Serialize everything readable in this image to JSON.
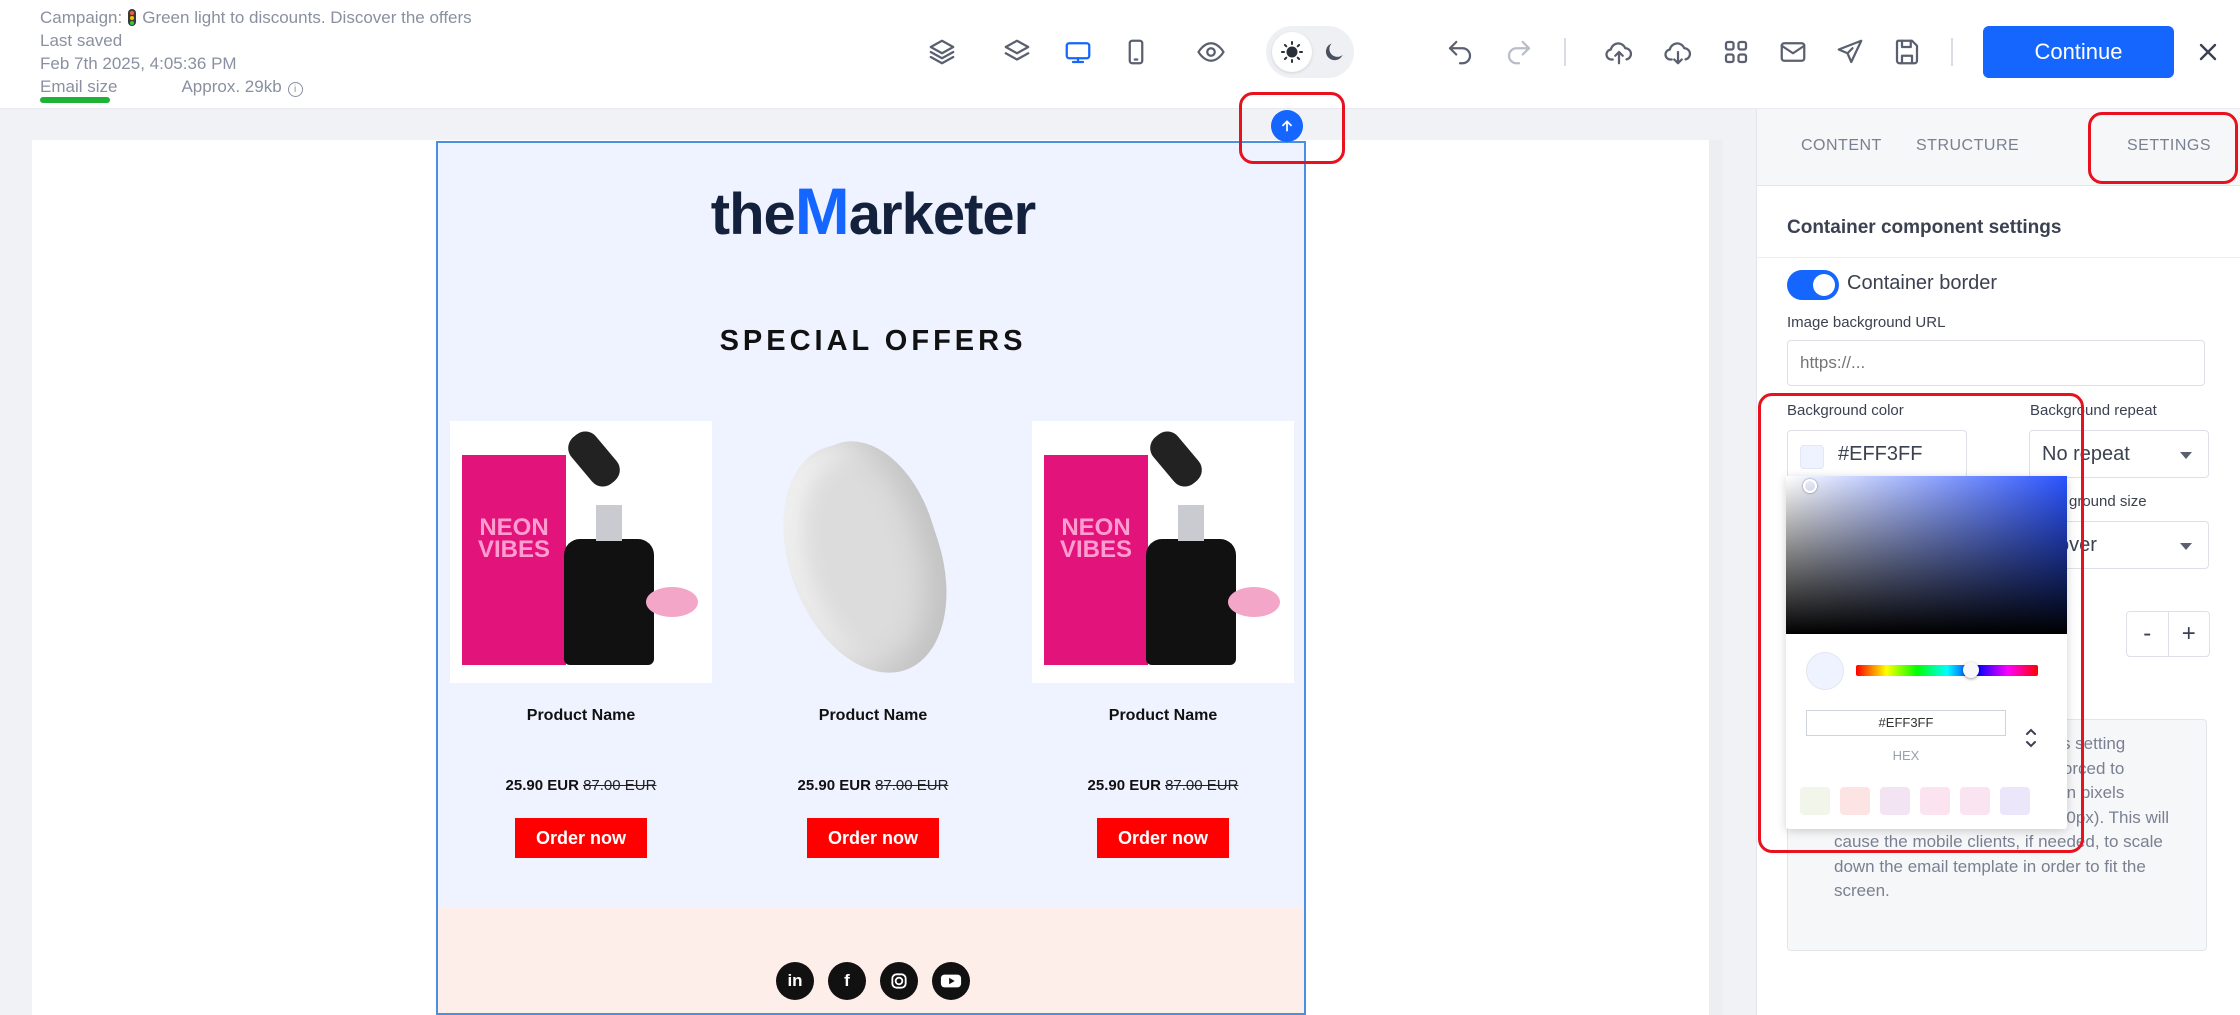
{
  "header": {
    "campaign_prefix": "Campaign:",
    "campaign_name": "Green light to discounts. Discover the offers",
    "last_saved_label": "Last saved",
    "last_saved_time": "Feb 7th 2025, 4:05:36 PM",
    "email_size_label": "Email size",
    "email_size_value": "Approx. 29kb",
    "email_size_indicator_color": "#1db334"
  },
  "toolbar": {
    "icons": [
      "layers-outline-icon",
      "layers-icon",
      "desktop-icon",
      "mobile-icon",
      "preview-eye-icon",
      "sun-icon",
      "moon-icon",
      "undo-icon",
      "redo-icon",
      "upload-icon",
      "download-icon",
      "modules-grid-icon",
      "email-icon",
      "send-icon",
      "save-icon",
      "close-icon"
    ],
    "active_view": "desktop",
    "continue_label": "Continue",
    "accent_color": "#1565ff"
  },
  "email": {
    "logo_prefix": "the",
    "logo_letter": "M",
    "logo_suffix": "arketer",
    "headline": "SPECIAL OFFERS",
    "products": [
      {
        "name": "Product Name",
        "price": "25.90 EUR",
        "old_price": "87.00 EUR",
        "button": "Order now",
        "image": "neon-vibes-serum"
      },
      {
        "name": "Product Name",
        "price": "25.90 EUR",
        "old_price": "87.00 EUR",
        "button": "Order now",
        "image": "white-shape"
      },
      {
        "name": "Product Name",
        "price": "25.90 EUR",
        "old_price": "87.00 EUR",
        "button": "Order now",
        "image": "neon-vibes-serum"
      }
    ],
    "socials": [
      "in",
      "f",
      "ig",
      "yt"
    ],
    "container_bg": "#eff3ff",
    "footer_bg": "#fdeeea",
    "button_color": "#ff0000"
  },
  "panel": {
    "tabs": [
      "CONTENT",
      "STRUCTURE",
      "SETTINGS"
    ],
    "active_tab": "SETTINGS",
    "section_title": "Container component settings",
    "container_border_label": "Container border",
    "container_border_on": true,
    "image_bg_label": "Image background URL",
    "image_bg_placeholder": "https://...",
    "bg_color_label": "Background color",
    "bg_color_value": "#EFF3FF",
    "bg_repeat_label": "Background repeat",
    "bg_repeat_value": "No repeat",
    "bg_size_label_partial": "ground size",
    "bg_size_value_partial": "over",
    "stepper_minus": "-",
    "stepper_plus": "+",
    "info_lines": [
      "this setting",
      "e forced to",
      "e, in pixels",
      "(minimum 500px, maximum 700px). This will",
      "cause the mobile clients, if needed, to scale",
      "down the email template in order to fit the",
      "screen."
    ]
  },
  "color_picker": {
    "hex_value": "#EFF3FF",
    "mode_label": "HEX",
    "presets": [
      "#f1f5ea",
      "#fde4e4",
      "#f3e4f4",
      "#fbe4ef",
      "#fbe4f1",
      "#ece6fb"
    ]
  },
  "highlights": [
    "scroll-up-button",
    "settings-tab",
    "background-color-picker"
  ]
}
